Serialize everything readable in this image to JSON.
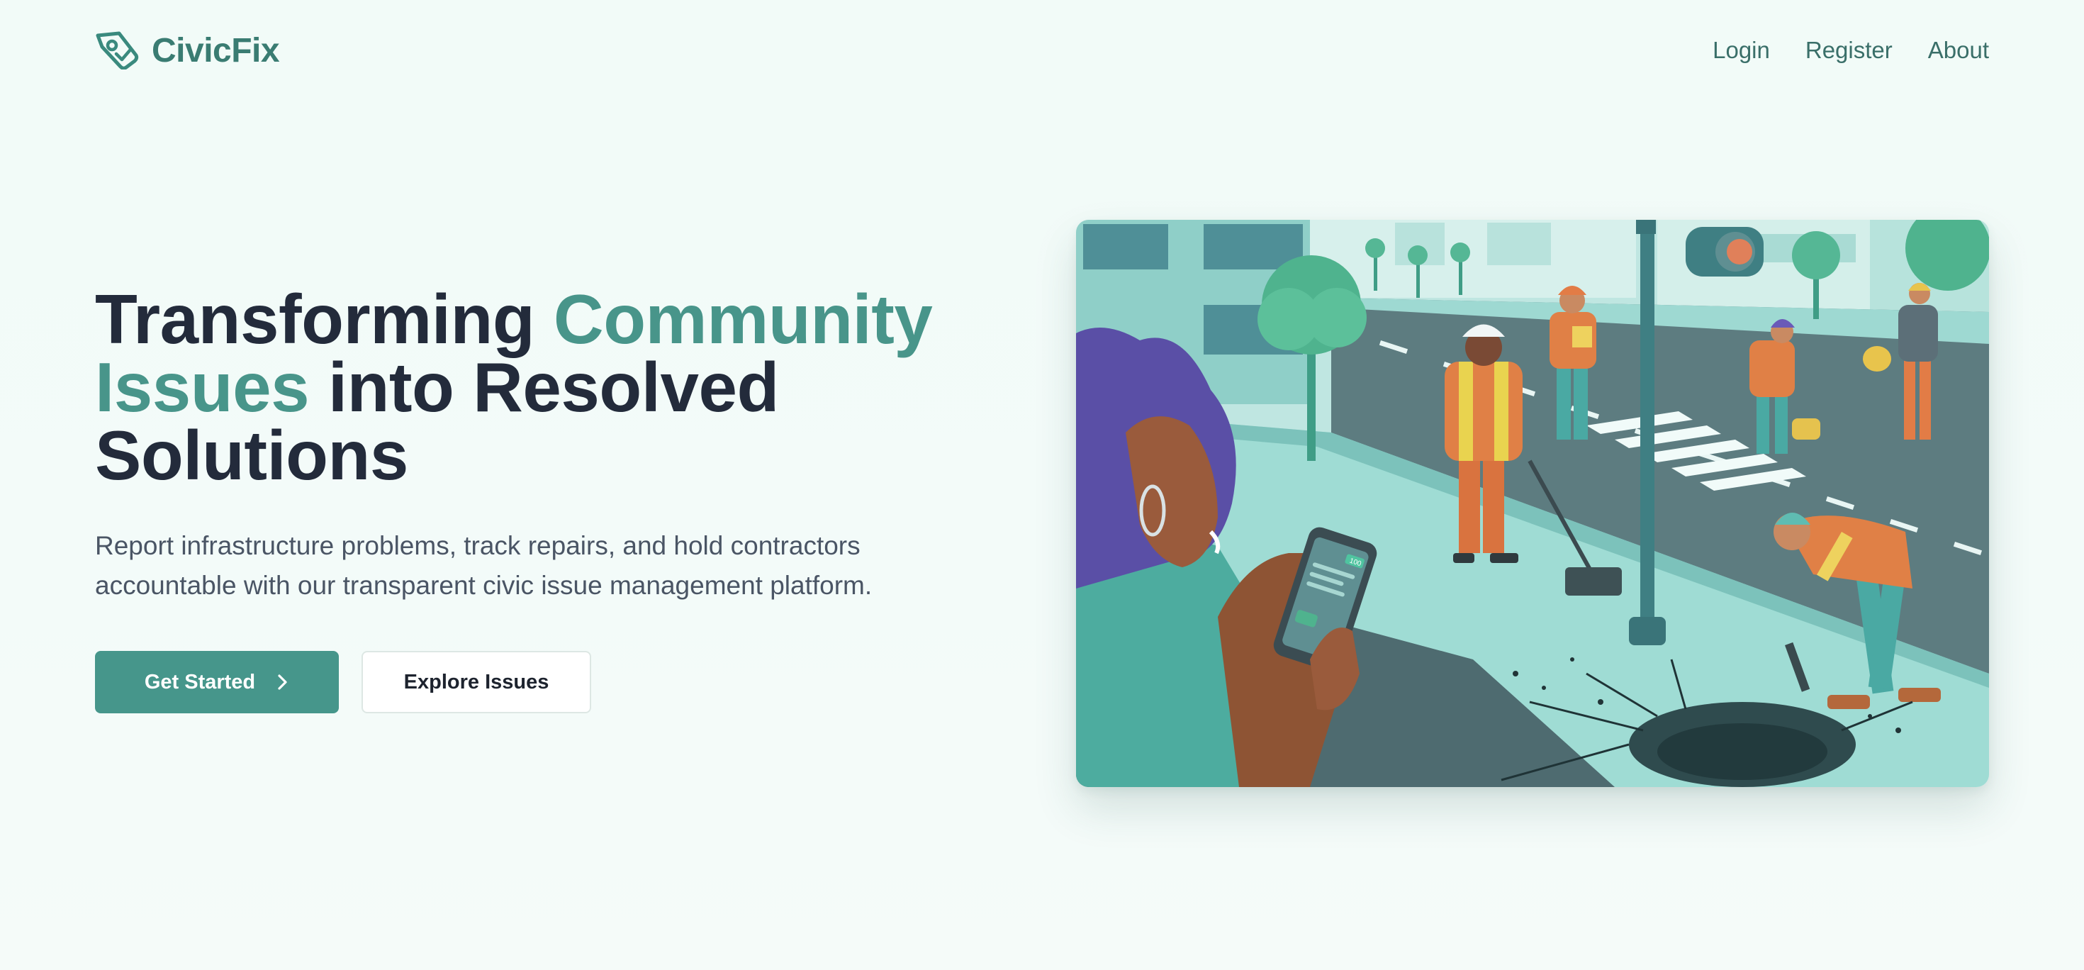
{
  "brand": {
    "name": "CivicFix",
    "icon": "tag-check-icon"
  },
  "nav": {
    "login": "Login",
    "register": "Register",
    "about": "About"
  },
  "hero": {
    "title_part1": "Transforming ",
    "title_accent1": "Community",
    "title_accent2": "Issues",
    "title_part2": " into Resolved",
    "title_part3": "Solutions",
    "subtitle": "Report infrastructure problems, track repairs, and hold contractors accountable with our transparent civic issue management platform.",
    "primary_button": "Get Started",
    "primary_button_icon": "chevron-right-icon",
    "secondary_button": "Explore Issues"
  },
  "illustration": {
    "subject": "street-repair-scene",
    "phone_badge": "100"
  },
  "colors": {
    "accent": "#48958a",
    "brand": "#3a7c72",
    "heading": "#232b3b",
    "body_text": "#4a5565",
    "background": "#f3fcf9"
  }
}
